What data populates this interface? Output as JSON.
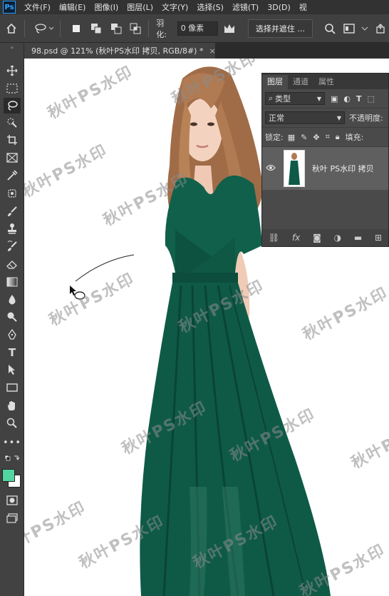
{
  "menu": {
    "logo": "Ps",
    "items": [
      "文件(F)",
      "编辑(E)",
      "图像(I)",
      "图层(L)",
      "文字(Y)",
      "选择(S)",
      "滤镜(T)",
      "3D(D)",
      "视"
    ]
  },
  "options": {
    "feather_label": "羽化:",
    "feather_value": "0 像素",
    "select_mask": "选择并遮住 ..."
  },
  "document_tab": {
    "title": "98.psd @ 121% (秋叶PS水印 拷贝, RGB/8#) *",
    "close": "×"
  },
  "layers_panel": {
    "tabs": [
      "图层",
      "通道",
      "属性"
    ],
    "filter_kind": "类型",
    "blend_mode": "正常",
    "opacity_label": "不透明度:",
    "lock_label": "锁定:",
    "fill_label": "填充:",
    "layer_name": "秋叶 PS水印 拷贝"
  },
  "watermark": "秋叶PS水印",
  "colors": {
    "foreground": "#52d6a0",
    "background": "#ffffff",
    "dress": "#0f5a47",
    "hair": "#b07a52",
    "skin": "#f3d3bf"
  }
}
